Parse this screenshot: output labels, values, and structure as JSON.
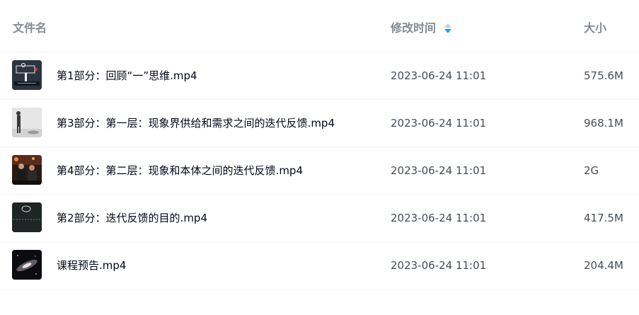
{
  "header": {
    "name_label": "文件名",
    "time_label": "修改时间",
    "size_label": "大小"
  },
  "files": [
    {
      "name": "第1部分：回顾“一”思维.mp4",
      "modified": "2023-06-24 11:01",
      "size": "575.6M",
      "thumbnail": "video-thumbnail-diagram"
    },
    {
      "name": "第3部分：第一层：现象界供给和需求之间的迭代反馈.mp4",
      "modified": "2023-06-24 11:01",
      "size": "968.1M",
      "thumbnail": "video-thumbnail-person"
    },
    {
      "name": "第4部分：第二层：现象和本体之间的迭代反馈.mp4",
      "modified": "2023-06-24 11:01",
      "size": "2G",
      "thumbnail": "video-thumbnail-scene"
    },
    {
      "name": "第2部分：迭代反馈的目的.mp4",
      "modified": "2023-06-24 11:01",
      "size": "417.5M",
      "thumbnail": "video-thumbnail-dark-diagram"
    },
    {
      "name": "课程预告.mp4",
      "modified": "2023-06-24 11:01",
      "size": "204.4M",
      "thumbnail": "video-thumbnail-galaxy"
    }
  ],
  "colors": {
    "sort_active": "#06a7ff",
    "sort_inactive": "#c7ccd4",
    "divider": "#f1f2f4"
  }
}
